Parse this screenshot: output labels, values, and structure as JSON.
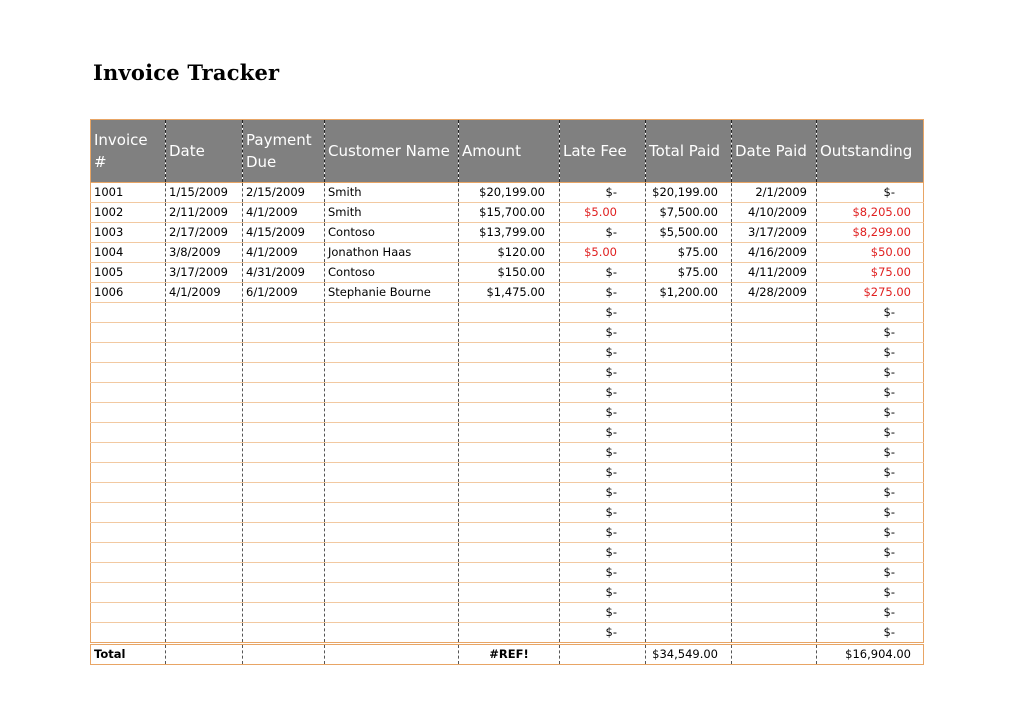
{
  "title": "Invoice Tracker",
  "columns": [
    "Invoice #",
    "Date",
    "Payment Due",
    "Customer Name",
    "Amount",
    "Late Fee",
    "Total Paid",
    "Date Paid",
    "Outstanding"
  ],
  "rows": [
    {
      "invoice": "1001",
      "date": "1/15/2009",
      "due": "2/15/2009",
      "customer": "Smith",
      "amount": "$20,199.00",
      "late_fee": "$-",
      "late_fee_red": false,
      "total_paid": "$20,199.00",
      "date_paid": "2/1/2009",
      "outstanding": "$-",
      "outstanding_red": false
    },
    {
      "invoice": "1002",
      "date": "2/11/2009",
      "due": "4/1/2009",
      "customer": "Smith",
      "amount": "$15,700.00",
      "late_fee": "$5.00",
      "late_fee_red": true,
      "total_paid": "$7,500.00",
      "date_paid": "4/10/2009",
      "outstanding": "$8,205.00",
      "outstanding_red": true
    },
    {
      "invoice": "1003",
      "date": "2/17/2009",
      "due": "4/15/2009",
      "customer": "Contoso",
      "amount": "$13,799.00",
      "late_fee": "$-",
      "late_fee_red": false,
      "total_paid": "$5,500.00",
      "date_paid": "3/17/2009",
      "outstanding": "$8,299.00",
      "outstanding_red": true
    },
    {
      "invoice": "1004",
      "date": "3/8/2009",
      "due": "4/1/2009",
      "customer": "Jonathon Haas",
      "amount": "$120.00",
      "late_fee": "$5.00",
      "late_fee_red": true,
      "total_paid": "$75.00",
      "date_paid": "4/16/2009",
      "outstanding": "$50.00",
      "outstanding_red": true
    },
    {
      "invoice": "1005",
      "date": "3/17/2009",
      "due": "4/31/2009",
      "customer": "Contoso",
      "amount": "$150.00",
      "late_fee": "$-",
      "late_fee_red": false,
      "total_paid": "$75.00",
      "date_paid": "4/11/2009",
      "outstanding": "$75.00",
      "outstanding_red": true
    },
    {
      "invoice": "1006",
      "date": "4/1/2009",
      "due": "6/1/2009",
      "customer": "Stephanie Bourne",
      "amount": "$1,475.00",
      "late_fee": "$-",
      "late_fee_red": false,
      "total_paid": "$1,200.00",
      "date_paid": "4/28/2009",
      "outstanding": "$275.00",
      "outstanding_red": true
    },
    {
      "invoice": "",
      "date": "",
      "due": "",
      "customer": "",
      "amount": "",
      "late_fee": "$-",
      "late_fee_red": false,
      "total_paid": "",
      "date_paid": "",
      "outstanding": "$-",
      "outstanding_red": false
    },
    {
      "invoice": "",
      "date": "",
      "due": "",
      "customer": "",
      "amount": "",
      "late_fee": "$-",
      "late_fee_red": false,
      "total_paid": "",
      "date_paid": "",
      "outstanding": "$-",
      "outstanding_red": false
    },
    {
      "invoice": "",
      "date": "",
      "due": "",
      "customer": "",
      "amount": "",
      "late_fee": "$-",
      "late_fee_red": false,
      "total_paid": "",
      "date_paid": "",
      "outstanding": "$-",
      "outstanding_red": false
    },
    {
      "invoice": "",
      "date": "",
      "due": "",
      "customer": "",
      "amount": "",
      "late_fee": "$-",
      "late_fee_red": false,
      "total_paid": "",
      "date_paid": "",
      "outstanding": "$-",
      "outstanding_red": false
    },
    {
      "invoice": "",
      "date": "",
      "due": "",
      "customer": "",
      "amount": "",
      "late_fee": "$-",
      "late_fee_red": false,
      "total_paid": "",
      "date_paid": "",
      "outstanding": "$-",
      "outstanding_red": false
    },
    {
      "invoice": "",
      "date": "",
      "due": "",
      "customer": "",
      "amount": "",
      "late_fee": "$-",
      "late_fee_red": false,
      "total_paid": "",
      "date_paid": "",
      "outstanding": "$-",
      "outstanding_red": false
    },
    {
      "invoice": "",
      "date": "",
      "due": "",
      "customer": "",
      "amount": "",
      "late_fee": "$-",
      "late_fee_red": false,
      "total_paid": "",
      "date_paid": "",
      "outstanding": "$-",
      "outstanding_red": false
    },
    {
      "invoice": "",
      "date": "",
      "due": "",
      "customer": "",
      "amount": "",
      "late_fee": "$-",
      "late_fee_red": false,
      "total_paid": "",
      "date_paid": "",
      "outstanding": "$-",
      "outstanding_red": false
    },
    {
      "invoice": "",
      "date": "",
      "due": "",
      "customer": "",
      "amount": "",
      "late_fee": "$-",
      "late_fee_red": false,
      "total_paid": "",
      "date_paid": "",
      "outstanding": "$-",
      "outstanding_red": false
    },
    {
      "invoice": "",
      "date": "",
      "due": "",
      "customer": "",
      "amount": "",
      "late_fee": "$-",
      "late_fee_red": false,
      "total_paid": "",
      "date_paid": "",
      "outstanding": "$-",
      "outstanding_red": false
    },
    {
      "invoice": "",
      "date": "",
      "due": "",
      "customer": "",
      "amount": "",
      "late_fee": "$-",
      "late_fee_red": false,
      "total_paid": "",
      "date_paid": "",
      "outstanding": "$-",
      "outstanding_red": false
    },
    {
      "invoice": "",
      "date": "",
      "due": "",
      "customer": "",
      "amount": "",
      "late_fee": "$-",
      "late_fee_red": false,
      "total_paid": "",
      "date_paid": "",
      "outstanding": "$-",
      "outstanding_red": false
    },
    {
      "invoice": "",
      "date": "",
      "due": "",
      "customer": "",
      "amount": "",
      "late_fee": "$-",
      "late_fee_red": false,
      "total_paid": "",
      "date_paid": "",
      "outstanding": "$-",
      "outstanding_red": false
    },
    {
      "invoice": "",
      "date": "",
      "due": "",
      "customer": "",
      "amount": "",
      "late_fee": "$-",
      "late_fee_red": false,
      "total_paid": "",
      "date_paid": "",
      "outstanding": "$-",
      "outstanding_red": false
    },
    {
      "invoice": "",
      "date": "",
      "due": "",
      "customer": "",
      "amount": "",
      "late_fee": "$-",
      "late_fee_red": false,
      "total_paid": "",
      "date_paid": "",
      "outstanding": "$-",
      "outstanding_red": false
    },
    {
      "invoice": "",
      "date": "",
      "due": "",
      "customer": "",
      "amount": "",
      "late_fee": "$-",
      "late_fee_red": false,
      "total_paid": "",
      "date_paid": "",
      "outstanding": "$-",
      "outstanding_red": false
    },
    {
      "invoice": "",
      "date": "",
      "due": "",
      "customer": "",
      "amount": "",
      "late_fee": "$-",
      "late_fee_red": false,
      "total_paid": "",
      "date_paid": "",
      "outstanding": "$-",
      "outstanding_red": false
    }
  ],
  "totals": {
    "label": "Total",
    "amount": "#REF!",
    "total_paid": "$34,549.00",
    "outstanding": "$16,904.00"
  },
  "colors": {
    "header_bg": "#808080",
    "border_accent": "#e8a565",
    "negative_red": "#e02020"
  }
}
